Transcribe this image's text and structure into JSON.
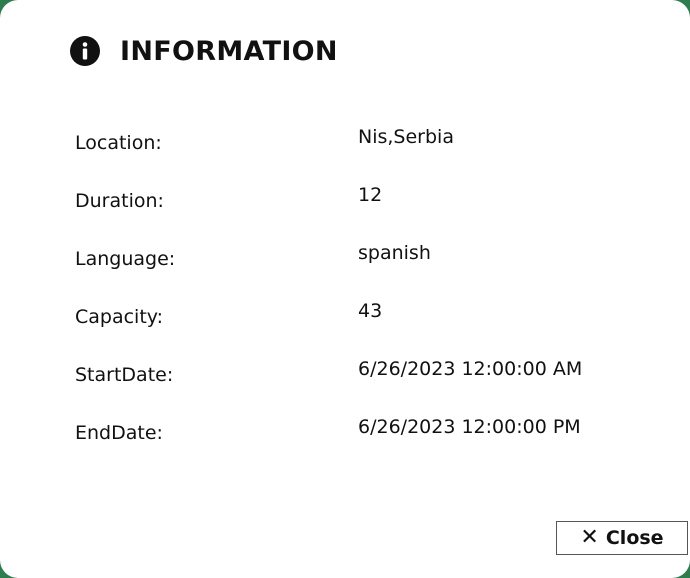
{
  "dialog": {
    "title": "INFORMATION",
    "icon": "info-icon",
    "fields": [
      {
        "label": "Location:",
        "value": "Nis,Serbia"
      },
      {
        "label": "Duration:",
        "value": "12"
      },
      {
        "label": "Language:",
        "value": "spanish"
      },
      {
        "label": "Capacity:",
        "value": "43"
      },
      {
        "label": "StartDate:",
        "value": "6/26/2023 12:00:00 AM"
      },
      {
        "label": "EndDate:",
        "value": "6/26/2023 12:00:00 PM"
      }
    ],
    "close_button": {
      "icon": "close-icon",
      "glyph": "✕",
      "label": "Close"
    }
  }
}
